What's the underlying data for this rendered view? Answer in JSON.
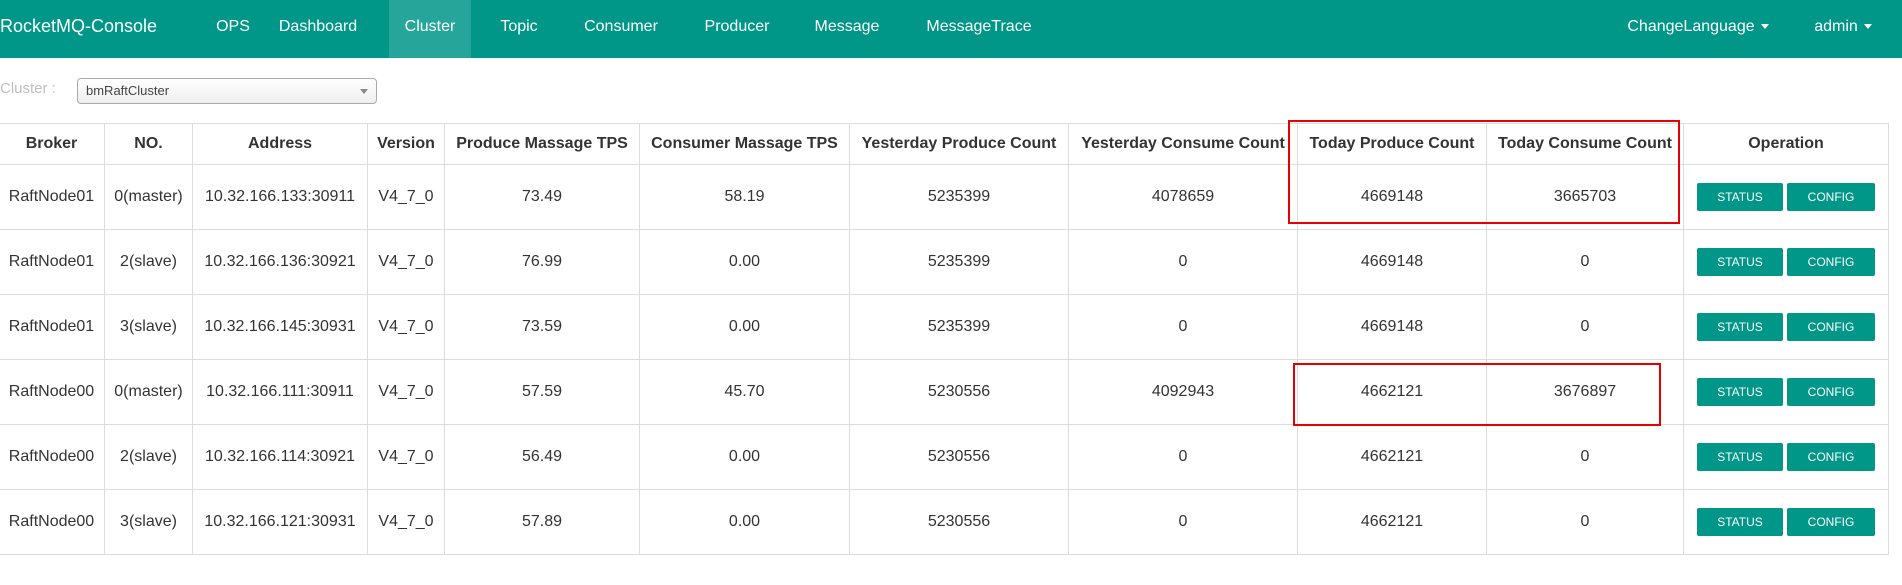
{
  "navbar": {
    "brand": "RocketMQ-Console",
    "items": [
      {
        "label": "OPS"
      },
      {
        "label": "Dashboard"
      },
      {
        "label": "Cluster"
      },
      {
        "label": "Topic"
      },
      {
        "label": "Consumer"
      },
      {
        "label": "Producer"
      },
      {
        "label": "Message"
      },
      {
        "label": "MessageTrace"
      }
    ],
    "active_item": "Cluster",
    "change_language": "ChangeLanguage",
    "user": "admin"
  },
  "filter": {
    "label": "Cluster :",
    "selected": "bmRaftCluster"
  },
  "table": {
    "headers": [
      "Broker",
      "NO.",
      "Address",
      "Version",
      "Produce Massage TPS",
      "Consumer Massage TPS",
      "Yesterday Produce Count",
      "Yesterday Consume Count",
      "Today Produce Count",
      "Today Consume Count",
      "Operation"
    ],
    "rows": [
      {
        "broker": "RaftNode01",
        "no": "0(master)",
        "address": "10.32.166.133:30911",
        "version": "V4_7_0",
        "produce_tps": "73.49",
        "consume_tps": "58.19",
        "yesterday_produce": "5235399",
        "yesterday_consume": "4078659",
        "today_produce": "4669148",
        "today_consume": "3665703"
      },
      {
        "broker": "RaftNode01",
        "no": "2(slave)",
        "address": "10.32.166.136:30921",
        "version": "V4_7_0",
        "produce_tps": "76.99",
        "consume_tps": "0.00",
        "yesterday_produce": "5235399",
        "yesterday_consume": "0",
        "today_produce": "4669148",
        "today_consume": "0"
      },
      {
        "broker": "RaftNode01",
        "no": "3(slave)",
        "address": "10.32.166.145:30931",
        "version": "V4_7_0",
        "produce_tps": "73.59",
        "consume_tps": "0.00",
        "yesterday_produce": "5235399",
        "yesterday_consume": "0",
        "today_produce": "4669148",
        "today_consume": "0"
      },
      {
        "broker": "RaftNode00",
        "no": "0(master)",
        "address": "10.32.166.111:30911",
        "version": "V4_7_0",
        "produce_tps": "57.59",
        "consume_tps": "45.70",
        "yesterday_produce": "5230556",
        "yesterday_consume": "4092943",
        "today_produce": "4662121",
        "today_consume": "3676897"
      },
      {
        "broker": "RaftNode00",
        "no": "2(slave)",
        "address": "10.32.166.114:30921",
        "version": "V4_7_0",
        "produce_tps": "56.49",
        "consume_tps": "0.00",
        "yesterday_produce": "5230556",
        "yesterday_consume": "0",
        "today_produce": "4662121",
        "today_consume": "0"
      },
      {
        "broker": "RaftNode00",
        "no": "3(slave)",
        "address": "10.32.166.121:30931",
        "version": "V4_7_0",
        "produce_tps": "57.89",
        "consume_tps": "0.00",
        "yesterday_produce": "5230556",
        "yesterday_consume": "0",
        "today_produce": "4662121",
        "today_consume": "0"
      }
    ],
    "status_label": "STATUS",
    "config_label": "CONFIG"
  },
  "colors": {
    "navbar": "#009688",
    "nav_active": "#26a69a",
    "button": "#009688",
    "highlight": "#e60000"
  }
}
